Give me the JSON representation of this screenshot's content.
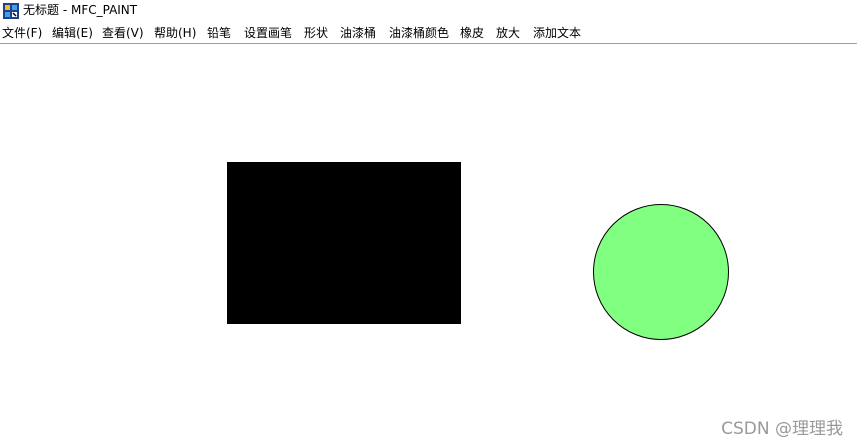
{
  "window": {
    "title": "无标题 - MFC_PAINT"
  },
  "menu": {
    "items": [
      "文件(F)",
      "编辑(E)",
      "查看(V)",
      "帮助(H)",
      "铅笔",
      "设置画笔",
      "形状",
      "油漆桶",
      "油漆桶颜色",
      "橡皮",
      "放大",
      "添加文本"
    ]
  },
  "canvas": {
    "shapes": [
      {
        "kind": "rectangle",
        "fill": "#000000",
        "stroke": "#000000"
      },
      {
        "kind": "circle",
        "fill": "#80ff80",
        "stroke": "#000000"
      }
    ]
  },
  "watermark": "CSDN @理理我",
  "icons": {
    "app": "mfc-app-icon"
  }
}
